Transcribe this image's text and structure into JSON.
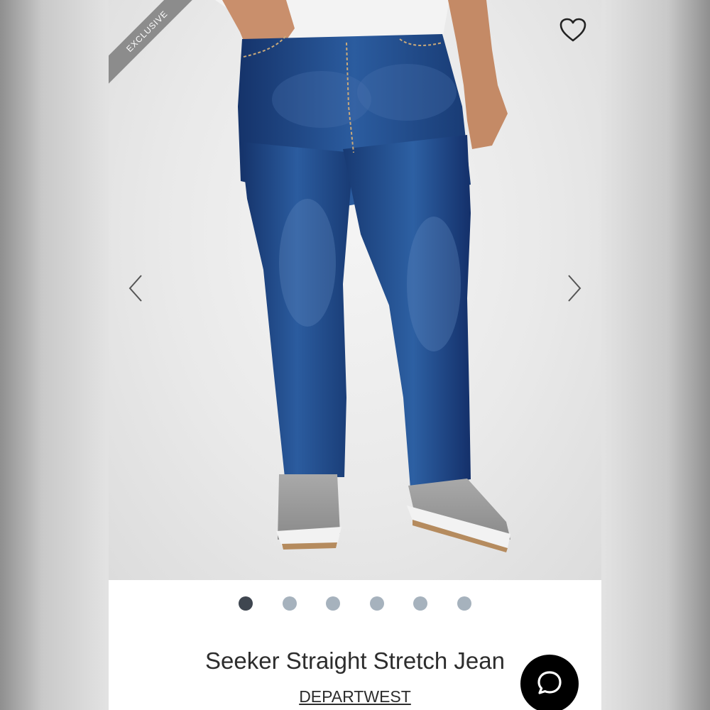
{
  "product": {
    "badge": "EXCLUSIVE",
    "title": "Seeker Straight Stretch Jean",
    "brand": "DEPARTWEST"
  },
  "gallery": {
    "image_count": 6,
    "active_index": 0
  },
  "icons": {
    "favorite": "heart-outline-icon",
    "prev": "chevron-left-icon",
    "next": "chevron-right-icon",
    "chat": "chat-bubble-icon"
  },
  "colors": {
    "badge_bg": "#8c8c8c",
    "dot_active": "#3f4650",
    "dot_inactive": "#a6b2bd",
    "denim": "#1f4783",
    "chat_bg": "#000000"
  }
}
